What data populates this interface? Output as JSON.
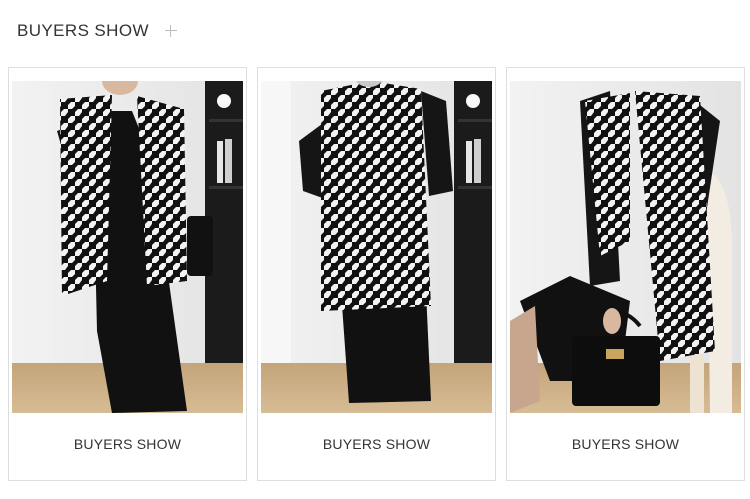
{
  "header": {
    "title": "BUYERS SHOW",
    "icon": "plus-icon"
  },
  "cards": [
    {
      "caption": "BUYERS SHOW",
      "photo": "model-front-houndstooth-vest"
    },
    {
      "caption": "BUYERS SHOW",
      "photo": "model-back-houndstooth-vest"
    },
    {
      "caption": "BUYERS SHOW",
      "photo": "model-seated-houndstooth-vest-handbag"
    }
  ],
  "colors": {
    "accent": "#333333",
    "border": "#dedede",
    "floor": "#c9ab82",
    "wall": "#ececec"
  }
}
